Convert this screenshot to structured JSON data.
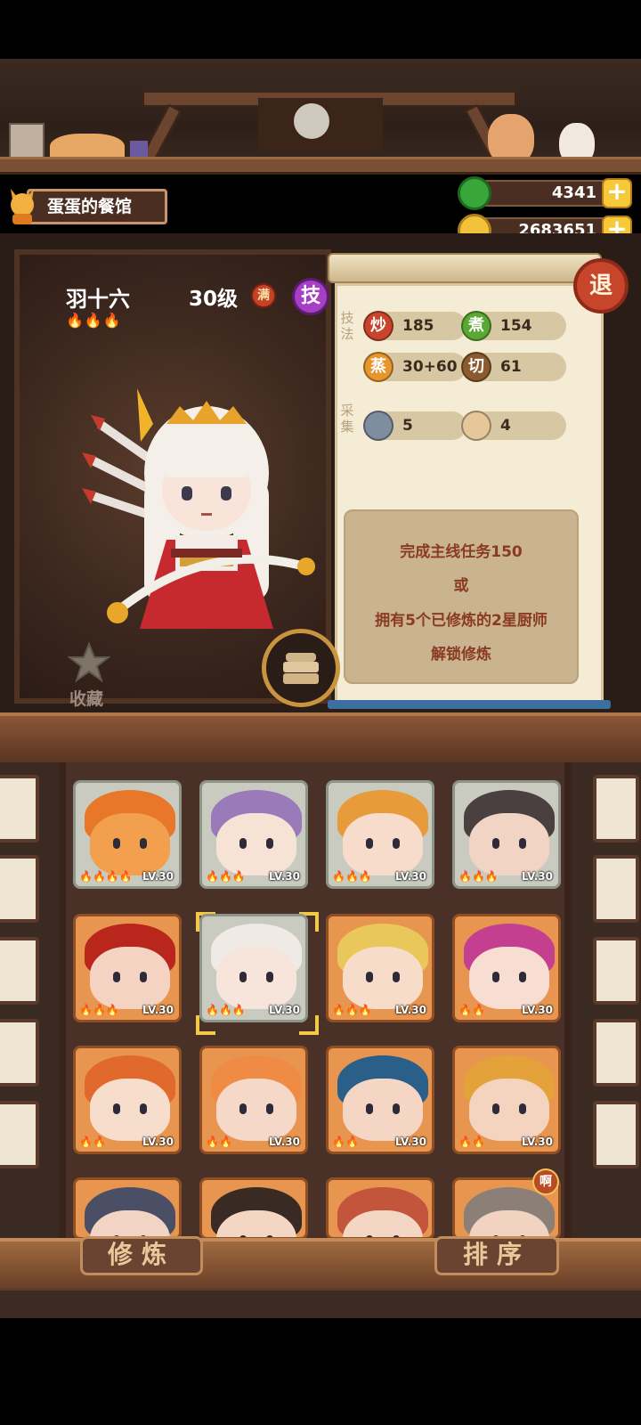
{
  "restaurant": {
    "name": "蛋蛋的餐馆"
  },
  "resources": {
    "jade": {
      "value": "4341",
      "icon": "green-jade-icon"
    },
    "coins": {
      "value": "2683651",
      "icon": "gold-coin-icon"
    },
    "plus_label": "+"
  },
  "exit_label": "退",
  "chef": {
    "name": "羽十六",
    "level": "30级",
    "stars": "🔥🔥🔥",
    "max_badge": "满",
    "skill_label": "技"
  },
  "stats": {
    "technique_label": "技法",
    "gather_label": "采集",
    "stir_fry": {
      "icon_label": "炒",
      "value": "185",
      "color": "#c8452c"
    },
    "boil": {
      "icon_label": "煮",
      "value": "154",
      "color": "#5aa832"
    },
    "steam": {
      "icon_label": "蒸",
      "value": "30+60",
      "color": "#e7962e"
    },
    "cut": {
      "icon_label": "切",
      "value": "61",
      "color": "#8b5a2e"
    },
    "fish": {
      "value": "5"
    },
    "bread": {
      "value": "4"
    }
  },
  "unlock": {
    "line1": "完成主线任务150",
    "line2": "或",
    "line3": "拥有5个已修炼的2星厨师",
    "line4": "解锁修炼"
  },
  "favorite_label": "收藏",
  "roster": {
    "level_text": "LV.30",
    "cards": [
      {
        "flames": "🔥🔥🔥🔥",
        "bg": "gray",
        "face": "#f3a04e",
        "hair": "#e8772a"
      },
      {
        "flames": "🔥🔥🔥",
        "bg": "gray",
        "face": "#f7e3d6",
        "hair": "#9b7ab9"
      },
      {
        "flames": "🔥🔥🔥",
        "bg": "gray",
        "face": "#f7dccb",
        "hair": "#e79b3a"
      },
      {
        "flames": "🔥🔥🔥",
        "bg": "gray",
        "face": "#f1d4c3",
        "hair": "#4a4040"
      },
      {
        "flames": "🔥🔥🔥",
        "bg": "orange",
        "face": "#f5d3c2",
        "hair": "#b8261c"
      },
      {
        "flames": "🔥🔥🔥",
        "bg": "gray",
        "face": "#f7e4da",
        "hair": "#efeae6"
      },
      {
        "flames": "🔥🔥🔥",
        "bg": "orange",
        "face": "#f7ddc9",
        "hair": "#e9c75a"
      },
      {
        "flames": "🔥🔥",
        "bg": "orange",
        "face": "#f7ddd2",
        "hair": "#c43f8f"
      },
      {
        "flames": "🔥🔥",
        "bg": "orange",
        "face": "#f7ddcc",
        "hair": "#e0692b"
      },
      {
        "flames": "🔥🔥",
        "bg": "orange",
        "face": "#f6d8c8",
        "hair": "#ef8b45"
      },
      {
        "flames": "🔥🔥",
        "bg": "orange",
        "face": "#f5d6c4",
        "hair": "#2a5f8a"
      },
      {
        "flames": "🔥🔥",
        "bg": "orange",
        "face": "#f4d3bf",
        "hair": "#e3a23a"
      },
      {
        "flames": "",
        "bg": "orange",
        "face": "#f2d4c4",
        "hair": "#4a4f66"
      },
      {
        "flames": "",
        "bg": "orange",
        "face": "#f4d6c4",
        "hair": "#3a2a24"
      },
      {
        "flames": "",
        "bg": "orange",
        "face": "#f4d6c4",
        "hair": "#c2553c"
      },
      {
        "flames": "",
        "bg": "orange",
        "face": "#f2d2c0",
        "hair": "#8b7f78"
      }
    ]
  },
  "new_badge": "啊",
  "buttons": {
    "train": "修炼",
    "sort": "排序"
  }
}
